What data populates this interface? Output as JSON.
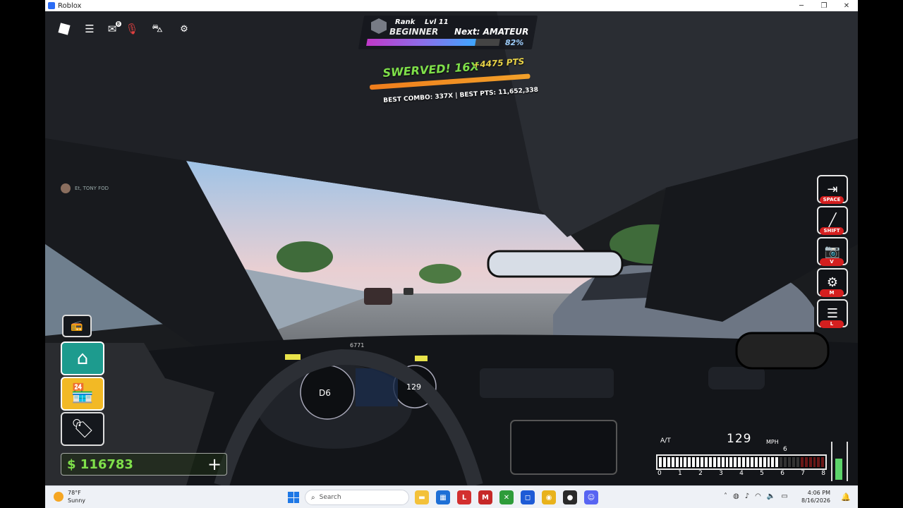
{
  "window": {
    "title": "Roblox",
    "controls": {
      "minimize": "─",
      "maximize": "❐",
      "close": "✕"
    }
  },
  "topbar": {
    "chat_badge": "8"
  },
  "rank": {
    "label": "Rank",
    "level": "Lvl 11",
    "name": "BEGINNER",
    "next": "Next: AMATEUR",
    "progress_pct": "82%",
    "progress_value": 0.82
  },
  "combo": {
    "title": "SWERVED! 16X",
    "points": "+4475 PTS",
    "best": "BEST COMBO: 337X  |  BEST PTS: 11,652,338",
    "bar_value": 1.0
  },
  "player_tag": "Et, TONY FOD",
  "right_controls": [
    {
      "name": "exit-vehicle-button",
      "icon": "door-exit-icon",
      "glyph": "⇥",
      "key": "SPACE"
    },
    {
      "name": "shift-button",
      "icon": "gear-lever-icon",
      "glyph": "╱",
      "key": "SHIFT"
    },
    {
      "name": "camera-button",
      "icon": "camera-icon",
      "glyph": "📷",
      "key": "V"
    },
    {
      "name": "manual-gear-button",
      "icon": "gearbox-icon",
      "glyph": "⚙",
      "key": "M"
    },
    {
      "name": "headlights-button",
      "icon": "headlight-icon",
      "glyph": "☰",
      "key": "L"
    }
  ],
  "left_controls": {
    "radio_icon": "radio-icon",
    "garage_icon": "garage-icon",
    "shop_icon": "shop-icon",
    "dealership_icon": "dealership-icon"
  },
  "money": {
    "amount": "$ 116783",
    "plus": "+"
  },
  "speedo": {
    "transmission": "A/T",
    "speed": "129",
    "unit": "MPH",
    "gear": "6",
    "rpm_segments_lit": 0.72,
    "rpm_ticks": [
      "0",
      "1",
      "2",
      "3",
      "4",
      "5",
      "6",
      "7",
      "8"
    ]
  },
  "dashboard": {
    "gear_display": "D6",
    "speed_display": "129",
    "odometer": "6771"
  },
  "taskbar": {
    "weather_temp": "78°F",
    "weather_cond": "Sunny",
    "search_placeholder": "Search",
    "time": "4:06 PM",
    "date": "8/16/2026",
    "pinned": [
      {
        "name": "file-explorer-icon",
        "color": "#f3c13a",
        "glyph": "▬"
      },
      {
        "name": "app-store-icon",
        "color": "#1d6fd6",
        "glyph": "▦"
      },
      {
        "name": "lastpass-icon",
        "color": "#d32f2f",
        "glyph": "L"
      },
      {
        "name": "mcafee-icon",
        "color": "#c62828",
        "glyph": "M"
      },
      {
        "name": "xbox-icon",
        "color": "#2e9c3a",
        "glyph": "✕"
      },
      {
        "name": "roblox-icon",
        "color": "#1e5bd6",
        "glyph": "◻"
      },
      {
        "name": "chrome-icon",
        "color": "#e8b21b",
        "glyph": "◉"
      },
      {
        "name": "obs-icon",
        "color": "#2a2a2a",
        "glyph": "●"
      },
      {
        "name": "discord-icon",
        "color": "#5865f2",
        "glyph": "☺"
      }
    ]
  },
  "colors": {
    "accent_green": "#7fe04a",
    "key_red": "#d41f1f",
    "garage_teal": "#1d9b8e",
    "shop_yellow": "#f2b925"
  }
}
